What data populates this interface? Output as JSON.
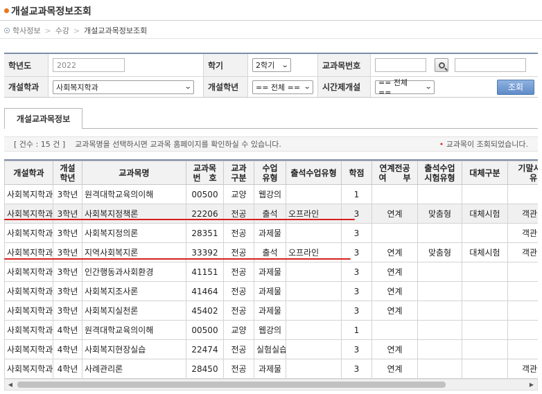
{
  "page": {
    "title": "개설교과목정보조회"
  },
  "breadcrumb": [
    "학사정보",
    "수강",
    "개설교과목정보조회"
  ],
  "search": {
    "year_label": "학년도",
    "year_value": "2022",
    "semester_label": "학기",
    "semester_value": "2학기",
    "course_no_label": "교과목번호",
    "course_no_value": "",
    "course_name_value": "",
    "dept_label": "개설학과",
    "dept_value": "사회복지학과",
    "grade_label": "개설학년",
    "grade_value": "== 전체 ==",
    "parttime_label": "시간제개설",
    "parttime_value": "== 전체 ==",
    "query_button": "조회"
  },
  "tab": {
    "label": "개설교과목정보"
  },
  "info": {
    "count": "[ 건수 : 15 건 ]",
    "message": "교과목명을 선택하시면 교과목 홈페이지를 확인하실 수 있습니다.",
    "status": "교과목이 조회되었습니다."
  },
  "table": {
    "headers": [
      "개설학과",
      "개설\n학년",
      "교과목명",
      "교과목\n번　호",
      "교과\n구분",
      "수업\n유형",
      "출석수업유형",
      "학점",
      "연계전공\n여　　부",
      "출석수업\n시험유형",
      "대체구분",
      "기말시험\n유"
    ],
    "rows": [
      [
        "사회복지학과",
        "3학년",
        "원격대학교육의이해",
        "00500",
        "교양",
        "웹강의",
        "",
        "1",
        "",
        "",
        "",
        ""
      ],
      [
        "사회복지학과",
        "3학년",
        "사회복지정책론",
        "22206",
        "전공",
        "출석",
        "오프라인",
        "3",
        "연계",
        "맞춤형",
        "대체시험",
        "객관식"
      ],
      [
        "사회복지학과",
        "3학년",
        "사회복지정의론",
        "28351",
        "전공",
        "과제물",
        "",
        "3",
        "",
        "",
        "",
        "객관식"
      ],
      [
        "사회복지학과",
        "3학년",
        "지역사회복지론",
        "33392",
        "전공",
        "출석",
        "오프라인",
        "3",
        "연계",
        "맞춤형",
        "대체시험",
        "객관식"
      ],
      [
        "사회복지학과",
        "3학년",
        "인간행동과사회환경",
        "41151",
        "전공",
        "과제물",
        "",
        "3",
        "연계",
        "",
        "",
        ""
      ],
      [
        "사회복지학과",
        "3학년",
        "사회복지조사론",
        "41464",
        "전공",
        "과제물",
        "",
        "3",
        "연계",
        "",
        "",
        ""
      ],
      [
        "사회복지학과",
        "3학년",
        "사회복지실천론",
        "45402",
        "전공",
        "과제물",
        "",
        "3",
        "연계",
        "",
        "",
        ""
      ],
      [
        "사회복지학과",
        "4학년",
        "원격대학교육의이해",
        "00500",
        "교양",
        "웹강의",
        "",
        "1",
        "",
        "",
        "",
        ""
      ],
      [
        "사회복지학과",
        "4학년",
        "사회복지현장실습",
        "22474",
        "전공",
        "실험실습",
        "",
        "3",
        "연계",
        "",
        "",
        ""
      ],
      [
        "사회복지학과",
        "4학년",
        "사례관리론",
        "28450",
        "전공",
        "과제물",
        "",
        "3",
        "연계",
        "",
        "",
        "객관식"
      ]
    ]
  },
  "colors": {
    "accent": "#e8771c",
    "highlight_line": "#d61f1f",
    "header_border": "#7d8ea8"
  }
}
